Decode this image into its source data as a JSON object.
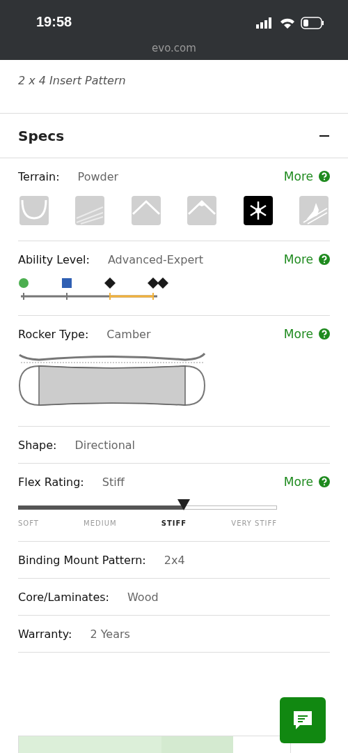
{
  "status_bar": {
    "time": "19:58",
    "url": "evo.com"
  },
  "binding_compatibility": {
    "value": "2 x 4 Insert Pattern"
  },
  "specs": {
    "title": "Specs",
    "expanded": true,
    "rows": [
      {
        "kind": "terrain",
        "label": "Terrain:",
        "value": "Powder",
        "more": "More",
        "terrains": [
          {
            "kind": "park",
            "selected": false
          },
          {
            "kind": "groomer",
            "selected": false
          },
          {
            "kind": "all-mountain",
            "selected": false
          },
          {
            "kind": "freeride",
            "selected": false
          },
          {
            "kind": "powder",
            "selected": true
          },
          {
            "kind": "backcountry",
            "selected": false
          }
        ]
      },
      {
        "kind": "ability",
        "label": "Ability Level:",
        "value": "Advanced-Expert",
        "more": "More",
        "levels": [
          {
            "kind": "circle",
            "color": "#4caf50",
            "selected": false
          },
          {
            "kind": "square",
            "color": "#2f5fb3",
            "selected": false
          },
          {
            "kind": "diamond",
            "color": "#1a1a1a",
            "selected": true
          },
          {
            "kind": "double-diamond",
            "color": "#1a1a1a",
            "selected": true
          }
        ]
      },
      {
        "kind": "rocker",
        "label": "Rocker Type:",
        "value": "Camber",
        "more": "More"
      },
      {
        "kind": "plain",
        "label": "Shape:",
        "value": "Directional"
      },
      {
        "kind": "flex",
        "label": "Flex Rating:",
        "value": "Stiff",
        "more": "More",
        "level": 0.64,
        "scale": [
          {
            "label": "SOFT",
            "selected": false
          },
          {
            "label": "MEDIUM",
            "selected": false
          },
          {
            "label": "STIFF",
            "selected": true
          },
          {
            "label": "VERY STIFF",
            "selected": false
          }
        ]
      },
      {
        "kind": "plain",
        "label": "Binding Mount Pattern:",
        "value": "2x4"
      },
      {
        "kind": "plain",
        "label": "Core/Laminates:",
        "value": "Wood"
      },
      {
        "kind": "plain",
        "label": "Warranty:",
        "value": "2 Years"
      }
    ]
  }
}
